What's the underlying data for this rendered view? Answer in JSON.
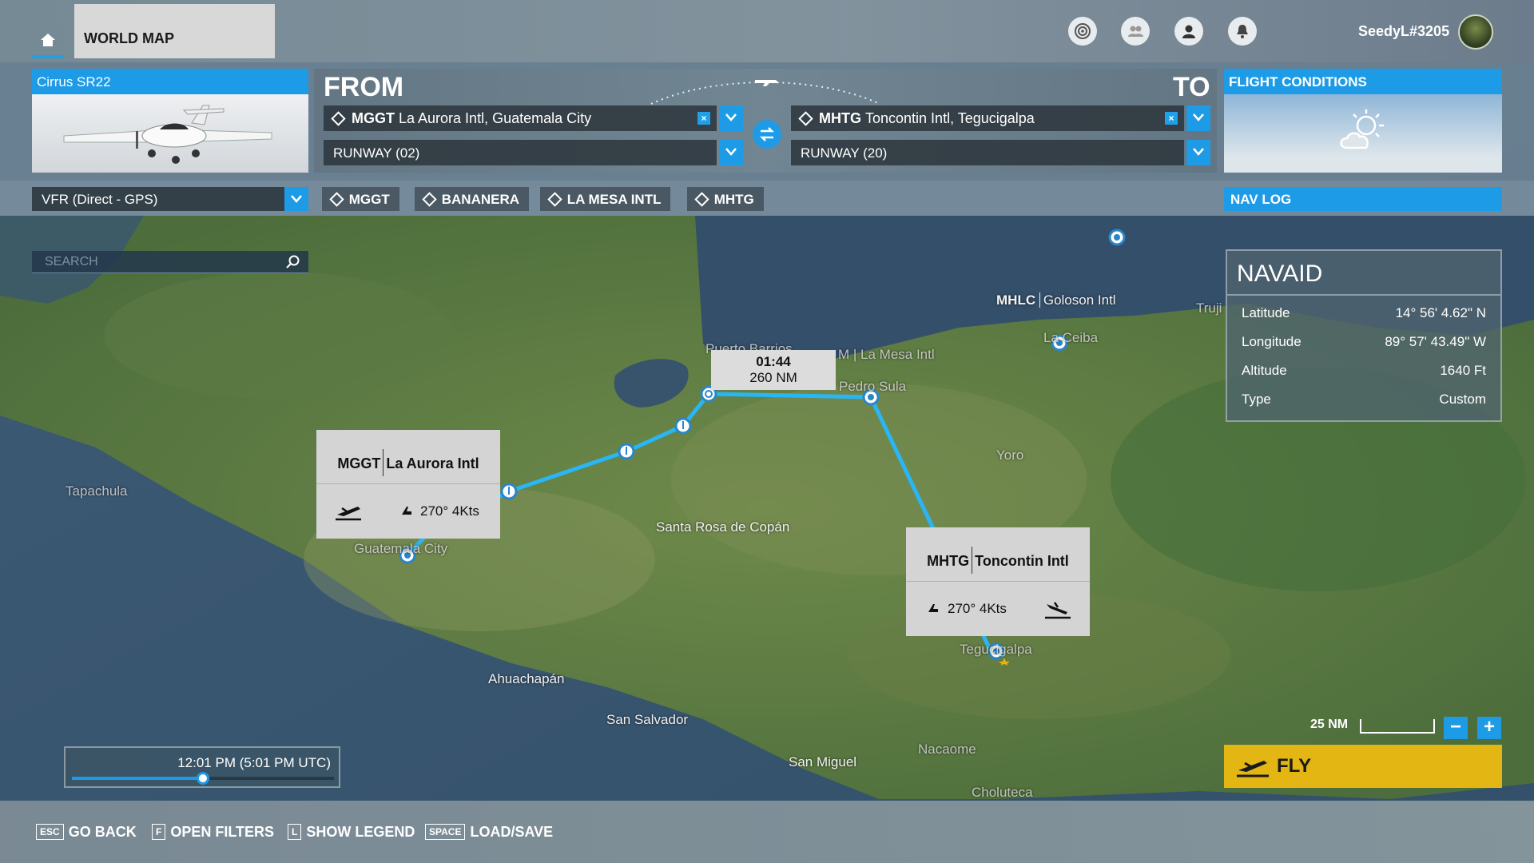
{
  "topbar": {
    "tab_label": "WORLD MAP",
    "username": "SeedyL#3205",
    "icons": [
      "achievements-icon",
      "friends-icon",
      "profile-icon",
      "notifications-icon"
    ]
  },
  "aircraft": {
    "label": "Cirrus SR22"
  },
  "route": {
    "from_title": "FROM",
    "to_title": "TO",
    "from": {
      "code": "MGGT",
      "name": "La Aurora Intl, Guatemala City",
      "runway": "RUNWAY (02)"
    },
    "to": {
      "code": "MHTG",
      "name": "Toncontin Intl, Tegucigalpa",
      "runway": "RUNWAY (20)"
    },
    "clear_glyph": "×"
  },
  "conditions": {
    "label": "FLIGHT CONDITIONS"
  },
  "flight_plan": {
    "type": "VFR (Direct - GPS)",
    "waypoints": [
      "MGGT",
      "BANANERA",
      "LA MESA INTL",
      "MHTG"
    ],
    "navlog_label": "NAV LOG"
  },
  "search": {
    "placeholder": "SEARCH"
  },
  "navaid": {
    "title": "NAVAID",
    "rows": [
      {
        "key": "Latitude",
        "value": "14° 56' 4.62\" N"
      },
      {
        "key": "Longitude",
        "value": "89° 57' 43.49\" W"
      },
      {
        "key": "Altitude",
        "value": "1640 Ft"
      },
      {
        "key": "Type",
        "value": "Custom"
      }
    ]
  },
  "popups": {
    "departure": {
      "code": "MGGT",
      "name": "La Aurora Intl",
      "wind": "270° 4Kts"
    },
    "arrival": {
      "code": "MHTG",
      "name": "Toncontin Intl",
      "wind": "270° 4Kts"
    }
  },
  "leg": {
    "time": "01:44",
    "distance": "260 NM"
  },
  "map_labels": {
    "tapachula": "Tapachula",
    "guatemala_city": "Guatemala City",
    "santa_rosa": "Santa Rosa de Copán",
    "ahuachapan": "Ahuachapán",
    "san_salvador": "San Salvador",
    "san_miguel": "San Miguel",
    "nacaome": "Nacaome",
    "choluteca": "Choluteca",
    "tegucigalpa": "Tegucigalpa",
    "yoro": "Yoro",
    "puerto_barrios": "Puerto Barrios",
    "la_mesa": "M | La Mesa Intl",
    "san_pedro_sula": "Pedro Sula",
    "mhlc_code": "MHLC",
    "mhlc_name": "Goloson Intl",
    "la_ceiba": "La Ceiba",
    "trujillo": "Truji"
  },
  "time_of_day": {
    "label": "12:01 PM (5:01 PM UTC)",
    "fraction": 0.5
  },
  "scale": {
    "label": "25 NM"
  },
  "zoom": {
    "minus": "−",
    "plus": "+"
  },
  "fly": {
    "label": "FLY"
  },
  "footer": {
    "items": [
      {
        "key": "ESC",
        "label": "GO BACK"
      },
      {
        "key": "F",
        "label": "OPEN FILTERS"
      },
      {
        "key": "L",
        "label": "SHOW LEGEND"
      },
      {
        "key": "SPACE",
        "label": "LOAD/SAVE"
      }
    ]
  },
  "colors": {
    "accent": "#1e9be6",
    "fly": "#e3b614",
    "route": "#29b6f6"
  }
}
